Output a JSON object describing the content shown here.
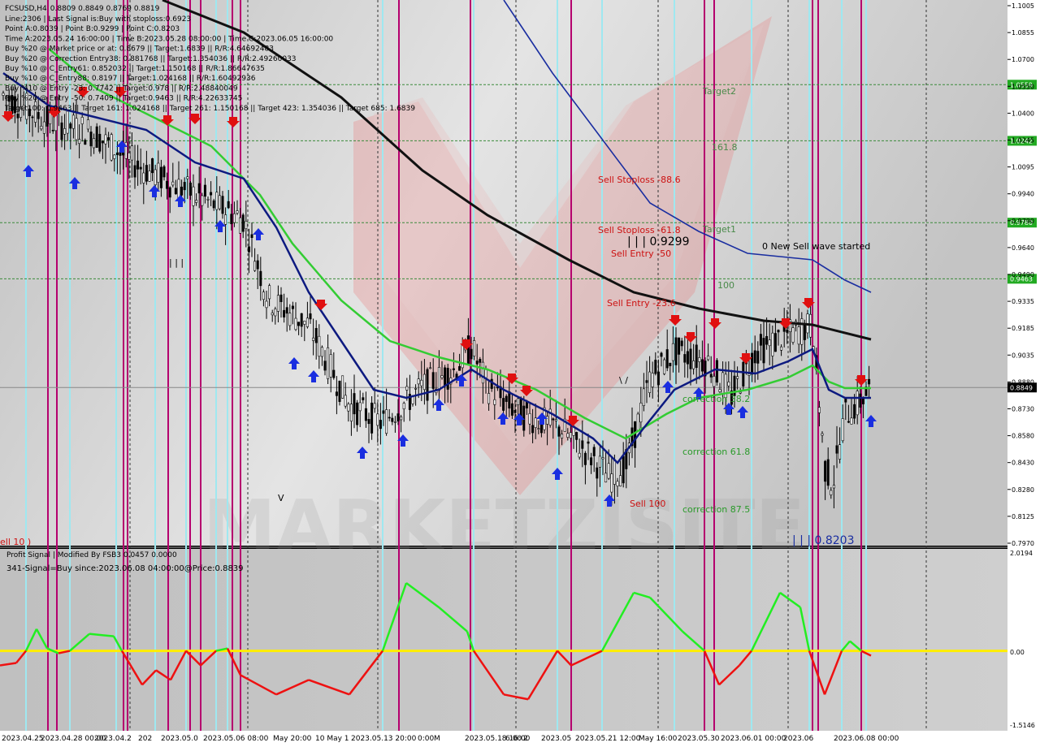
{
  "window": {
    "symbol_title": "FCSUSD,H4",
    "ohlc": "0.8809 0.8849 0.8769 0.8819"
  },
  "info_lines": [
    "Line:2306 | Last Signal is:Buy with stoploss:0.6923",
    "Point A:0.8039 | Point B:0.9299 | Point C:0.8203",
    "Time A:2023.05.24 16:00:00 | Time B:2023.05.28 08:00:00 | Time C:2023.06.05 16:00:00",
    "Buy %20 @ Market price or at: 0.8679 || Target:1.6839 || R/R:4.64692483",
    "Buy %20 @ Correction Entry38: 0.881768 || Target:1.354036 || R/R:2.49260033",
    "Buy %10 @ C_Entry61: 0.852032 || Target:1.150168 || R/R:1.86647635",
    "Buy %10 @ C_Entry88: 0.8197 || Target:1.024168 || R/R:1.60492936",
    "Buy %10 @ Entry -23: 0.7742 || Target:0.978 || R/R:2.48840049",
    "Buy %20 @ Entry -50: 0.7409 || Target:0.9463 || R/R:4.22633745",
    "Target100: 0.9463 || Target 161: 1.024168 || Target 261: 1.150168 || Target 423: 1.354036 || Target 685: 1.6839"
  ],
  "price_axis": {
    "ticks": [
      "1.1005",
      "1.0855",
      "1.0700",
      "1.0550",
      "1.0400",
      "1.0245",
      "1.0095",
      "0.9940",
      "0.9790",
      "0.9640",
      "0.9490",
      "0.9335",
      "0.9185",
      "0.9035",
      "0.8880",
      "0.8730",
      "0.8580",
      "0.8430",
      "0.8280",
      "0.8125",
      "0.7970"
    ],
    "min": 0.797,
    "max": 1.1005
  },
  "levels": [
    {
      "price": 1.0559,
      "label": "1.0559",
      "color": "#22aa22"
    },
    {
      "price": 1.0242,
      "label": "1.0242",
      "color": "#22aa22"
    },
    {
      "price": 0.978,
      "label": "0.9780",
      "color": "#22aa22"
    },
    {
      "price": 0.9463,
      "label": "0.9463",
      "color": "#22aa22"
    },
    {
      "price": 0.8849,
      "label": "0.8849",
      "color": "#000000"
    }
  ],
  "annotations": {
    "target2": "Target2",
    "fib1618": "161.8",
    "sell_stoploss_886": "Sell Stoploss -88.6",
    "sell_stoploss_618": "Sell Stoploss -61.8",
    "target1": "Target1",
    "point_b": "| | | 0.9299",
    "sell_entry_50": "Sell Entry -50",
    "new_sell_wave": "0 New Sell wave started",
    "fib100": "100",
    "sell_entry_236": "Sell Entry -23.6",
    "correction_382": "correction 38.2",
    "correction_618": "correction 61.8",
    "sell_100": "Sell 100",
    "correction_875": "correction 87.5",
    "point_c": "| | | 0.8203",
    "sell_left": "ell 10 )",
    "bars_marker": "| | |",
    "v_marker": "V",
    "vv_marker": "\\ /"
  },
  "indicator": {
    "title": "Profit Signal | Modified By FSB3 0.0457 0.0000",
    "signal_text": "341-Signal=Buy since:2023.06.08 04:00:00@Price:0.8839",
    "axis_top": "2.0194",
    "axis_zero": "0.00",
    "axis_bottom": "-1.5146",
    "min": -1.5146,
    "max": 2.0194
  },
  "time_axis": [
    "2023.04.25",
    "2023.04.28 00:00",
    "2023.04.2",
    "202",
    "2023.05.0",
    "2023.05.06 08:00",
    "May 20:00",
    "10 May 1",
    "2023.05.13 20:00",
    "0:00",
    "M",
    "2023.05.18 16:00",
    "6:00",
    "2",
    "2023.05",
    "2023.05.21 12:00",
    "May 16:00",
    "2023.05.30",
    "2023.06.01 00:00",
    "2023.06",
    "2023.06.08 00:00"
  ],
  "colors": {
    "chart_bg": "#c9c9c9",
    "magenta_line": "#b5006e",
    "cyan_line": "#9fe8f0",
    "ma_green": "#33cc33",
    "ma_navy": "#0d1a80",
    "ma_black": "#111111",
    "ma_blue_thin": "#1a2ea0",
    "signal_green": "#22ee22",
    "signal_red": "#ee1111",
    "zero_line": "#ffee00"
  },
  "chart_data": {
    "type": "candlestick",
    "title": "FCSUSD,H4",
    "ylim": [
      0.797,
      1.1005
    ],
    "current_price": 0.8849,
    "approx_close_path": [
      {
        "t": "2023.04.25",
        "close": 1.05
      },
      {
        "t": "2023.04.28",
        "close": 1.035
      },
      {
        "t": "2023.05.02",
        "close": 1.03
      },
      {
        "t": "2023.05.04",
        "close": 1.0
      },
      {
        "t": "2023.05.06",
        "close": 0.995
      },
      {
        "t": "2023.05.07",
        "close": 0.98
      },
      {
        "t": "2023.05.08",
        "close": 0.93
      },
      {
        "t": "2023.05.10",
        "close": 0.9
      },
      {
        "t": "2023.05.12",
        "close": 0.865
      },
      {
        "t": "2023.05.14",
        "close": 0.885
      },
      {
        "t": "2023.05.16",
        "close": 0.895
      },
      {
        "t": "2023.05.18",
        "close": 0.905
      },
      {
        "t": "2023.05.19",
        "close": 0.885
      },
      {
        "t": "2023.05.21",
        "close": 0.865
      },
      {
        "t": "2023.05.23",
        "close": 0.84
      },
      {
        "t": "2023.05.24",
        "close": 0.8039
      },
      {
        "t": "2023.05.26",
        "close": 0.87
      },
      {
        "t": "2023.05.28",
        "close": 0.9299
      },
      {
        "t": "2023.05.30",
        "close": 0.89
      },
      {
        "t": "2023.06.01",
        "close": 0.905
      },
      {
        "t": "2023.06.03",
        "close": 0.92
      },
      {
        "t": "2023.06.05",
        "close": 0.8203
      },
      {
        "t": "2023.06.07",
        "close": 0.87
      },
      {
        "t": "2023.06.08",
        "close": 0.8849
      }
    ]
  }
}
